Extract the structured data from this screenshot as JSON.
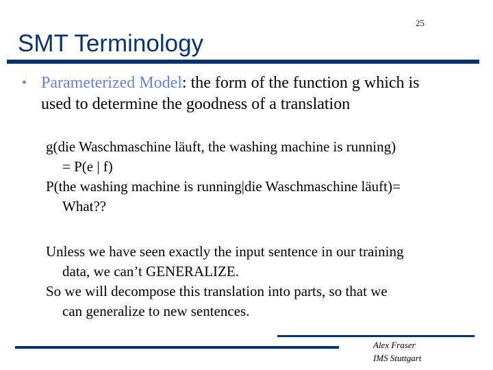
{
  "slide": {
    "number": "25",
    "title": "SMT Terminology",
    "bullet": {
      "term": "Parameterized Model",
      "text": ":  the form of the function g which is used to determine the goodness of a translation"
    },
    "paragraphs": [
      {
        "first": "g(die Waschmaschine läuft, the washing machine is running)",
        "rest": "= P(e | f)"
      },
      {
        "first": "P(the washing machine is running|die Waschmaschine läuft)=",
        "rest": "What??"
      },
      {
        "first": "Unless we have seen exactly the input sentence in our training",
        "rest": "data, we can’t GENERALIZE."
      },
      {
        "first": "So we will decompose this translation into parts, so that we",
        "rest": "can generalize to new sentences."
      }
    ],
    "footer": {
      "author": "Alex Fraser",
      "affiliation": "IMS Stuttgart"
    },
    "colors": {
      "title": "#0d3466",
      "accent_term": "#6a86c8"
    }
  }
}
